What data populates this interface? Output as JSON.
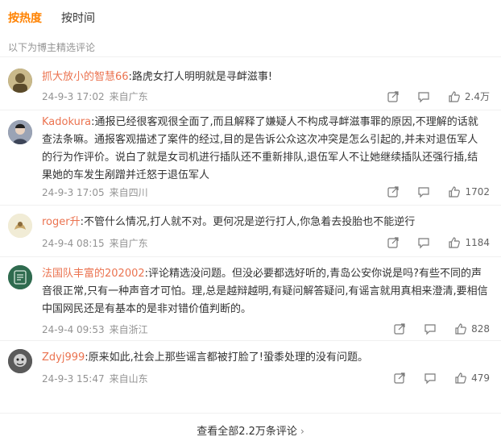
{
  "tabs": [
    {
      "label": "按热度",
      "active": true
    },
    {
      "label": "按时间",
      "active": false
    }
  ],
  "subtitle": "以下为博主精选评论",
  "comments": [
    {
      "user": "抓大放小的智慧66",
      "text": ":路虎女打人明明就是寻衅滋事!",
      "date": "24-9-3 17:02",
      "location": "来自广东",
      "likes": "2.4万",
      "avatar_color": "#8a7a4a"
    },
    {
      "user": "Kadokura",
      "text": ":通报已经很客观很全面了,而且解释了嫌疑人不构成寻衅滋事罪的原因,不理解的话就查法条嘛。通报客观描述了案件的经过,目的是告诉公众这次冲突是怎么引起的,并未对退伍军人的行为作评价。说白了就是女司机进行插队还不重新排队,退伍军人不让她继续插队还强行插,结果她的车发生剐蹭并迁怒于退伍军人",
      "date": "24-9-3 17:05",
      "location": "来自四川",
      "likes": "1702",
      "avatar_color": "#5a6478"
    },
    {
      "user": "roger升",
      "text": ":不管什么情况,打人就不对。更何况是逆行打人,你急着去投胎也不能逆行",
      "date": "24-9-4 08:15",
      "location": "来自广东",
      "likes": "1184",
      "avatar_color": "#e8e2c8"
    },
    {
      "user": "法国队丰富的202002",
      "text": ":评论精选没问题。但没必要都选好听的,青岛公安你说是吗?有些不同的声音很正常,只有一种声音才可怕。理,总是越辩越明,有疑问解答疑问,有谣言就用真相来澄清,要相信中国网民还是有基本的是非对错价值判断的。",
      "date": "24-9-4 09:53",
      "location": "来自浙江",
      "likes": "828",
      "avatar_color": "#2f6b4f"
    },
    {
      "user": "Zdyj999",
      "text": ":原来如此,社会上那些谣言都被打脸了!蛩黍处理的没有问题。",
      "date": "24-9-3 15:47",
      "location": "来自山东",
      "likes": "479",
      "avatar_color": "#4a4a4a"
    }
  ],
  "footer": {
    "label": "查看全部2.2万条评论",
    "chevron": "›"
  },
  "colors": {
    "accent": "#ff8200",
    "username": "#eb7350",
    "meta": "#939393"
  }
}
